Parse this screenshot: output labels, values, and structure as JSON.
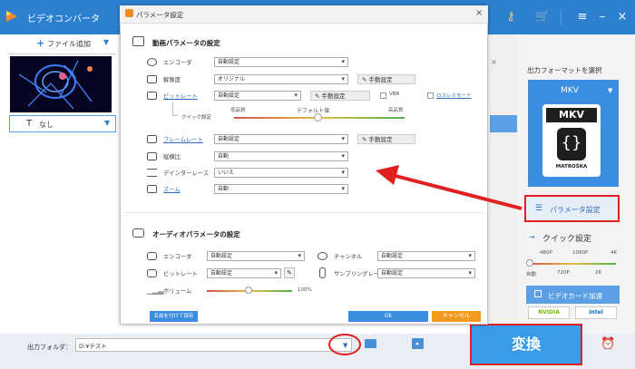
{
  "app": {
    "title": "ビデオコンバータ",
    "add_file": "ファイル追加",
    "subtitle_select": "なし"
  },
  "right_panel": {
    "output_format_label": "出力フォーマットを選択",
    "format_name": "MKV",
    "format_icon_top": "MKV",
    "format_icon_bottom": "MATROŠKA",
    "param_button": "パラメータ設定",
    "quick_title": "クイック設定",
    "quick_marks_top": [
      "480P",
      "1080P",
      "4K"
    ],
    "quick_marks_bottom": [
      "自動",
      "720P",
      "2K"
    ],
    "gpu_accel": "ビデオカード加速",
    "gpu_vendors": [
      "NVIDIA",
      "Intel"
    ]
  },
  "bottom": {
    "output_folder_label": "出力フォルダ：",
    "output_folder_value": "D:¥テスト",
    "convert_button": "変換"
  },
  "dialog": {
    "title": "パラメータ設定",
    "video_section": "動画パラメータの設定",
    "audio_section": "オーディオパラメータの設定",
    "video_rows": {
      "encoder": {
        "label": "エンコーダ",
        "value": "自動設定"
      },
      "resolution": {
        "label": "解像度",
        "value": "オリジナル",
        "manual": "手動設定"
      },
      "bitrate": {
        "label": "ビットレート",
        "value": "自動設定",
        "manual": "手動設定",
        "vbr": "VBR",
        "lossless": "ロスレスモード"
      },
      "quality": {
        "label": "クイック設定",
        "low": "低品質",
        "default": "デフォルト値",
        "high": "高品質"
      },
      "framerate": {
        "label": "フレームレート",
        "value": "自動設定",
        "manual": "手動設定"
      },
      "aspect": {
        "label": "縦横比",
        "value": "自動"
      },
      "deinterlace": {
        "label": "デインターレース",
        "value": "いいえ"
      },
      "zoom": {
        "label": "ズーム",
        "value": "自動"
      }
    },
    "audio_rows": {
      "encoder": {
        "label": "エンコーダ",
        "value": "自動設定"
      },
      "channel": {
        "label": "チャンネル",
        "value": "自動設定"
      },
      "bitrate": {
        "label": "ビットレート",
        "value": "自動設定"
      },
      "samplerate": {
        "label": "サンプリングレート",
        "value": "自動設定"
      },
      "volume": {
        "label": "ボリューム",
        "value": "100%"
      }
    },
    "save_as": "名前を付けて保存",
    "ok": "Ok",
    "cancel": "キャンセル"
  },
  "colors": {
    "accent": "#3a8de0",
    "cancel": "#f39a1e",
    "highlight": "#e02020"
  }
}
